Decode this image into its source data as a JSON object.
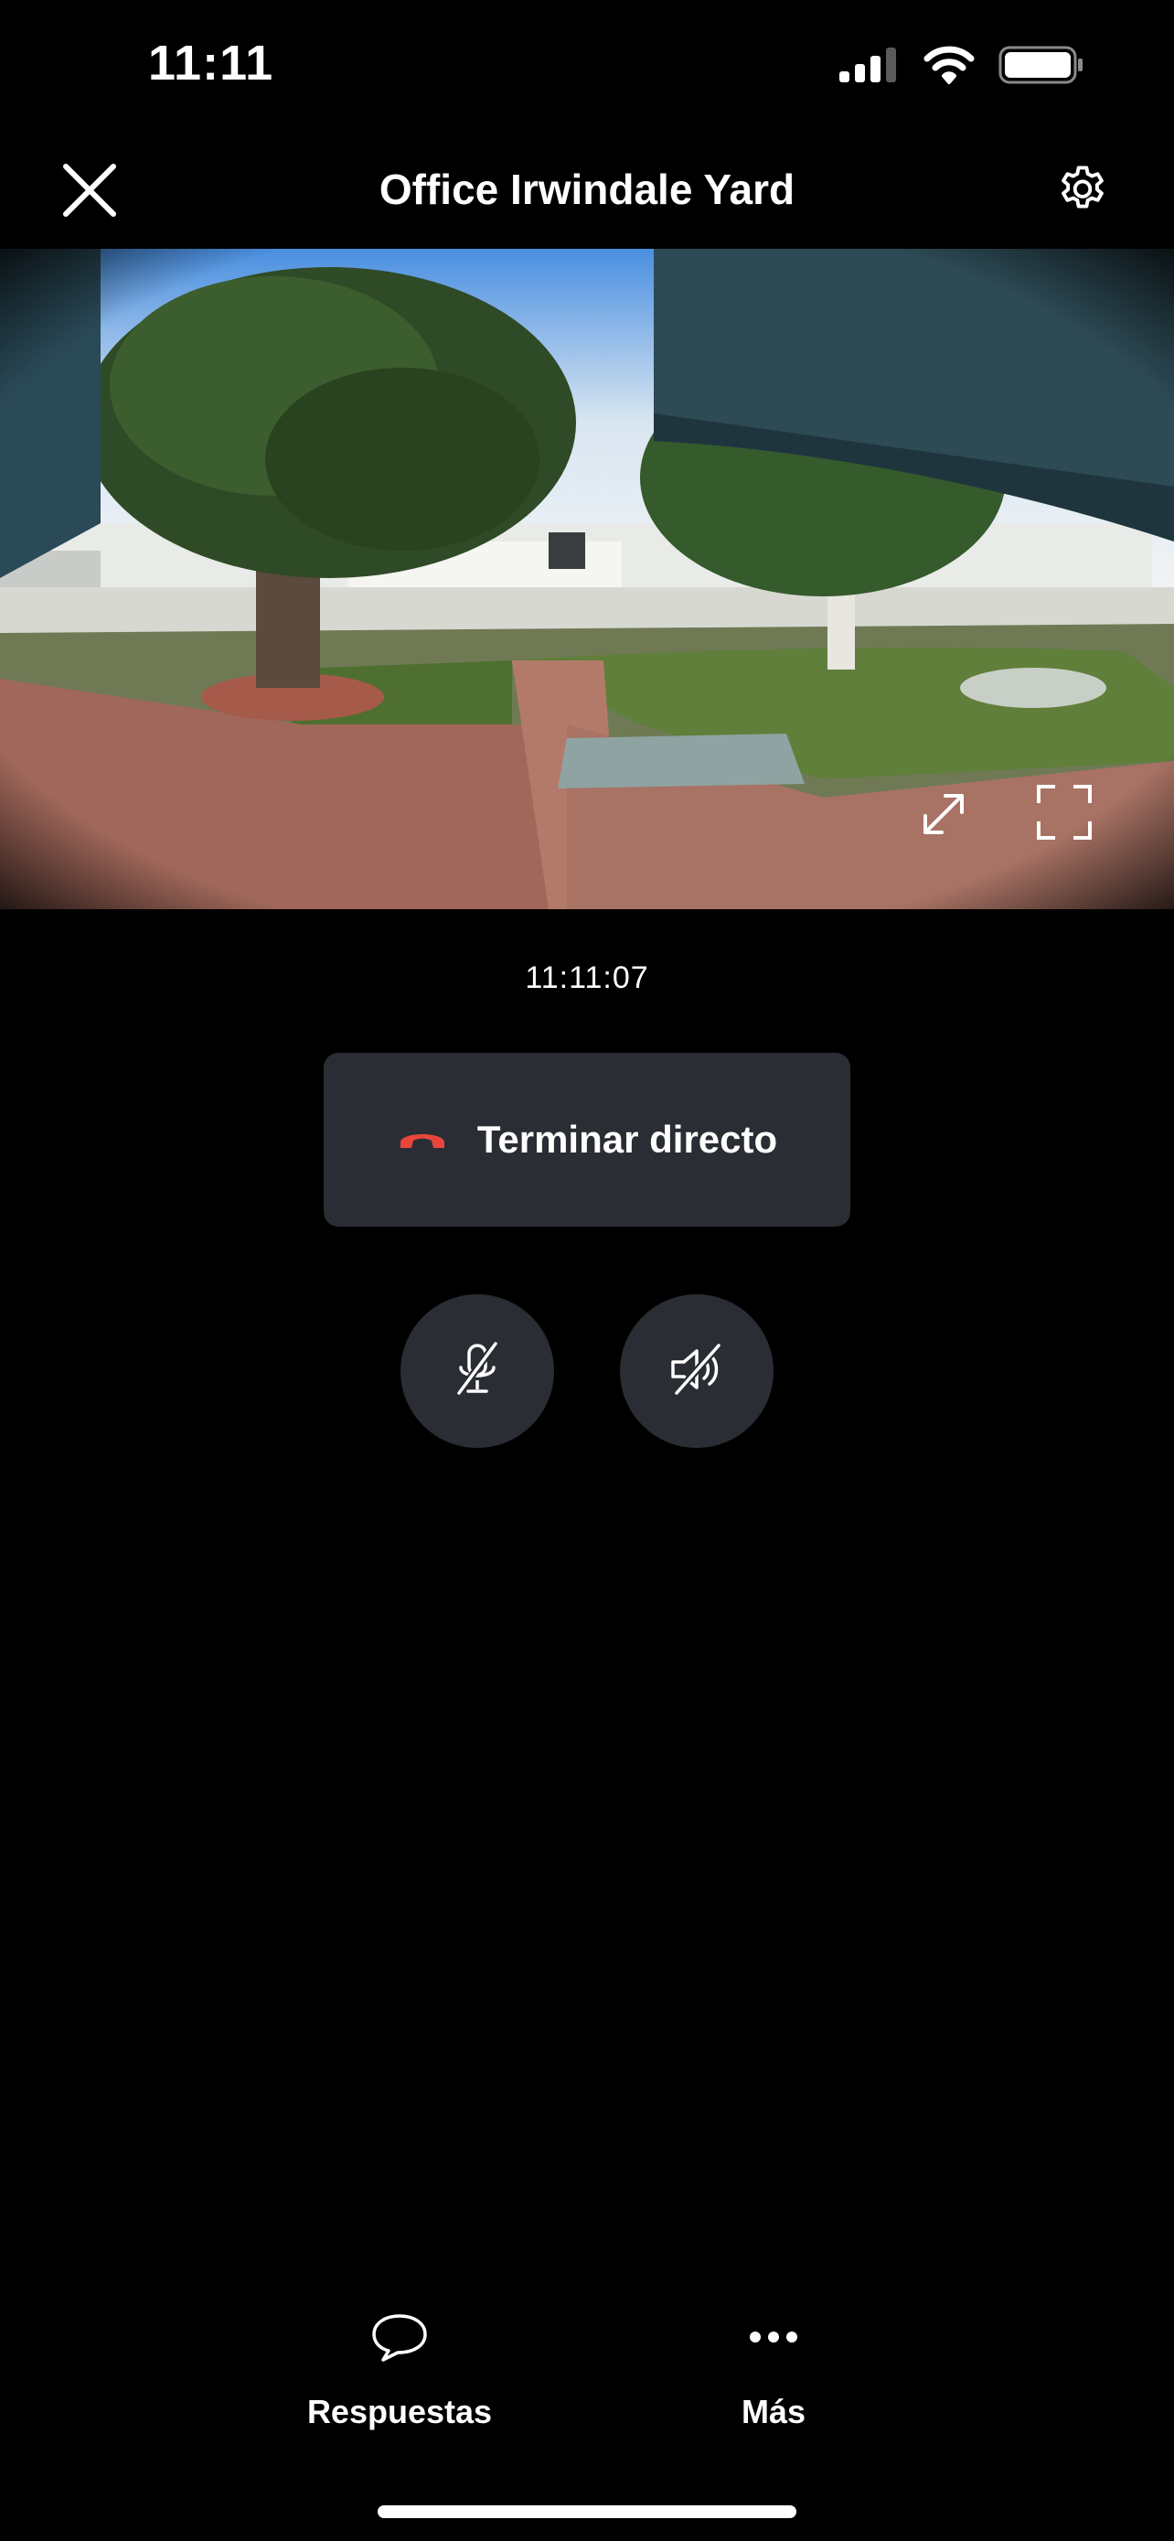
{
  "status_bar": {
    "time": "11:11",
    "icons": [
      "cellular-signal-icon",
      "wifi-icon",
      "battery-icon"
    ]
  },
  "header": {
    "title": "Office Irwindale Yard",
    "close_icon": "close-icon",
    "settings_icon": "gear-icon"
  },
  "camera": {
    "expand_icon": "expand-icon",
    "fullscreen_icon": "fullscreen-icon"
  },
  "live": {
    "timestamp": "11:11:07",
    "end_label": "Terminar directo",
    "end_icon": "hang-up-icon",
    "mic_icon": "mic-muted-icon",
    "speaker_icon": "speaker-muted-icon"
  },
  "bottom_nav": {
    "replies_label": "Respuestas",
    "more_label": "Más"
  },
  "colors": {
    "background": "#000000",
    "button_bg": "#2a2d33",
    "hangup_red": "#e8453c",
    "text": "#ffffff"
  }
}
